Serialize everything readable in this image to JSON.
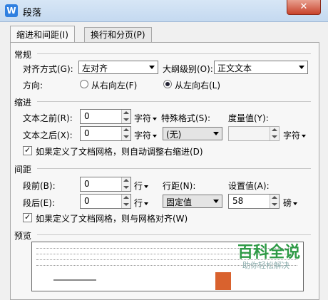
{
  "window": {
    "title": "段落",
    "app_icon_letter": "W",
    "close_glyph": "✕"
  },
  "tabs": [
    {
      "label": "缩进和间距(I)",
      "active": true
    },
    {
      "label": "换行和分页(P)",
      "active": false
    }
  ],
  "general": {
    "heading": "常规",
    "alignment_label": "对齐方式(G):",
    "alignment_value": "左对齐",
    "outline_label": "大纲级别(O):",
    "outline_value": "正文文本",
    "direction_label": "方向:",
    "rtl_label": "从右向左(F)",
    "ltr_label": "从左向右(L)",
    "selected_direction": "ltr"
  },
  "indent": {
    "heading": "缩进",
    "before_label": "文本之前(R):",
    "before_value": "0",
    "before_unit": "字符",
    "after_label": "文本之后(X):",
    "after_value": "0",
    "after_unit": "字符",
    "special_label": "特殊格式(S):",
    "special_value": "(无)",
    "measure_label": "度量值(Y):",
    "measure_value": "",
    "measure_unit": "字符",
    "auto_adjust_label": "如果定义了文档网格，则自动调整右缩进(D)",
    "auto_adjust_checked": true
  },
  "spacing": {
    "heading": "间距",
    "before_label": "段前(B):",
    "before_value": "0",
    "before_unit": "行",
    "after_label": "段后(E):",
    "after_value": "0",
    "after_unit": "行",
    "line_label": "行距(N):",
    "line_value": "固定值",
    "setting_label": "设置值(A):",
    "setting_value": "58",
    "setting_unit": "磅",
    "snap_label": "如果定义了文档网格，则与网格对齐(W)",
    "snap_checked": true
  },
  "preview": {
    "heading": "预览"
  },
  "watermark": {
    "title": "百科全说",
    "subtitle": "助你轻松解决"
  },
  "colors": {
    "accent": "#2f7fe0",
    "watermark_green": "#2e9a46",
    "close_red": "#c8432b"
  }
}
